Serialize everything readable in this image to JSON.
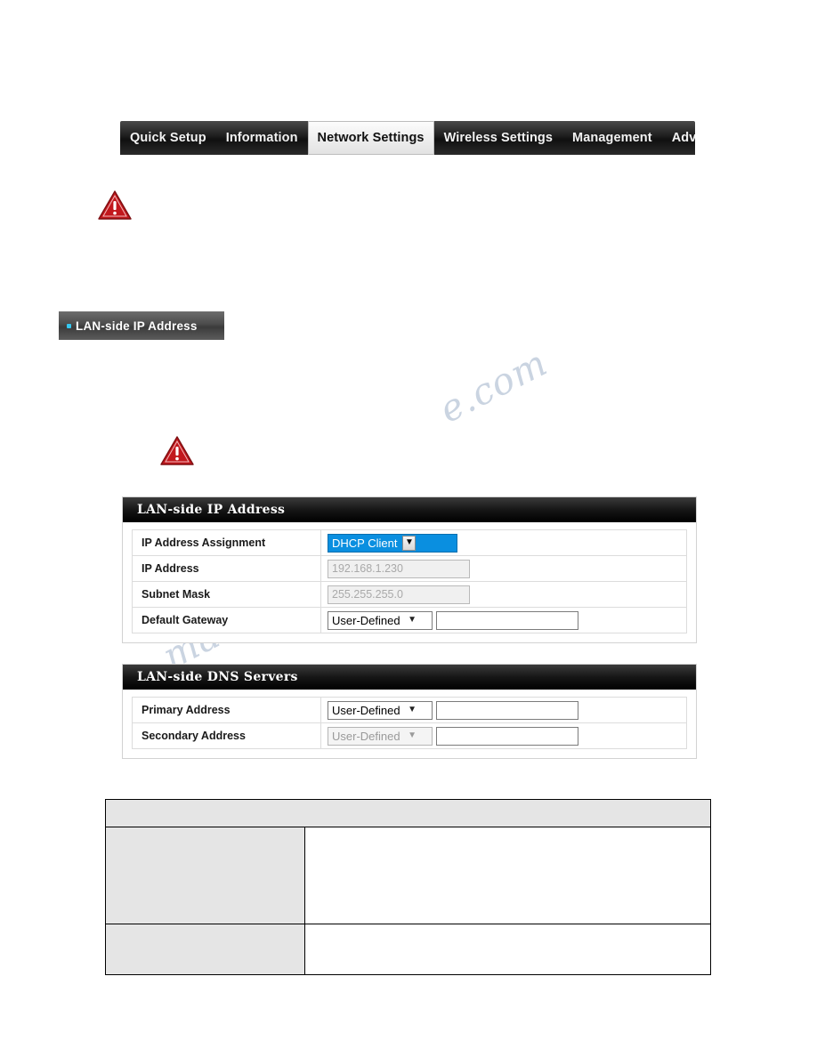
{
  "nav": {
    "tabs": [
      {
        "label": "Quick Setup",
        "active": false
      },
      {
        "label": "Information",
        "active": false
      },
      {
        "label": "Network Settings",
        "active": true
      },
      {
        "label": "Wireless Settings",
        "active": false
      },
      {
        "label": "Management",
        "active": false
      },
      {
        "label": "Advanced",
        "active": false
      }
    ]
  },
  "section_tab": {
    "label": "LAN-side IP Address",
    "bullet_color": "#35c7f0"
  },
  "warning_icons": {
    "top": "warning-triangle-icon",
    "middle": "warning-triangle-icon",
    "color": "#c2181d"
  },
  "panel_ip": {
    "title": "LAN-side IP Address",
    "rows": [
      {
        "label": "IP Address Assignment",
        "control": "select",
        "value": "DHCP Client",
        "state": "highlighted"
      },
      {
        "label": "IP Address",
        "control": "text",
        "value": "192.168.1.230",
        "state": "disabled"
      },
      {
        "label": "Subnet Mask",
        "control": "text",
        "value": "255.255.255.0",
        "state": "disabled"
      },
      {
        "label": "Default Gateway",
        "control": "select+text",
        "value": "User-Defined",
        "text_value": "",
        "state": "enabled"
      }
    ]
  },
  "panel_dns": {
    "title": "LAN-side DNS Servers",
    "rows": [
      {
        "label": "Primary Address",
        "control": "select+text",
        "value": "User-Defined",
        "text_value": "",
        "state": "enabled"
      },
      {
        "label": "Secondary Address",
        "control": "select+text",
        "value": "User-Defined",
        "text_value": "",
        "state": "disabled"
      }
    ]
  },
  "desc_table": {
    "header": "",
    "rows": [
      {
        "term": "",
        "definition": ""
      },
      {
        "term": "",
        "definition": ""
      }
    ]
  },
  "watermark": {
    "line1": "e.com",
    "line2": "manualzz"
  }
}
